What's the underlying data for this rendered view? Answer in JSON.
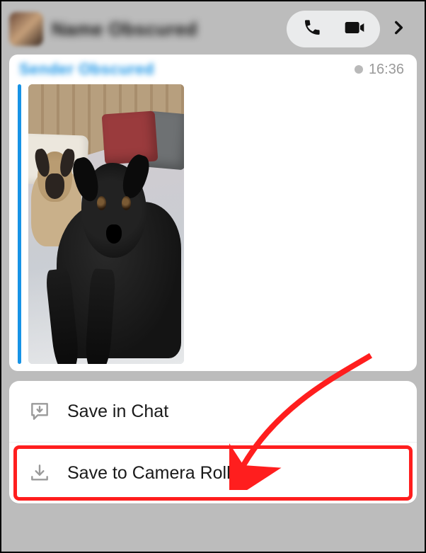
{
  "header": {
    "contact_name": "Name Obscured",
    "icons": {
      "phone": "phone-icon",
      "video": "video-icon",
      "chevron": "chevron-right-icon"
    }
  },
  "message": {
    "sender_name": "Sender Obscured",
    "timestamp": "16:36",
    "media_alt": "Photo of two pug dogs on a bed"
  },
  "menu": {
    "items": [
      {
        "label": "Save in Chat",
        "icon": "chat-download-icon"
      },
      {
        "label": "Save to Camera Roll",
        "icon": "download-tray-icon"
      }
    ]
  },
  "annotation": {
    "highlight_target": "save-to-camera-roll",
    "arrow_color": "#ff1e1e"
  }
}
